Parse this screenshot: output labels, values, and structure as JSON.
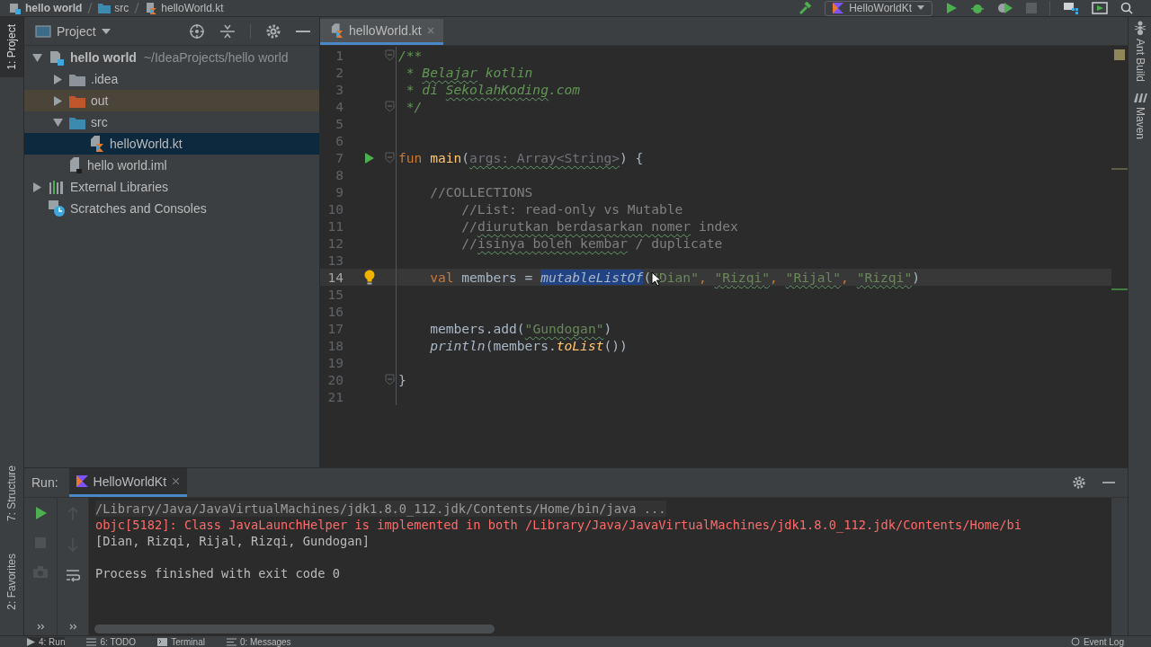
{
  "breadcrumbs": [
    {
      "kind": "module",
      "label": "hello world"
    },
    {
      "kind": "folder",
      "label": "src"
    },
    {
      "kind": "kotlin-file",
      "label": "helloWorld.kt"
    }
  ],
  "run_config": {
    "label": "HelloWorldKt"
  },
  "left_stripe": [
    {
      "label": "1: Project",
      "selected": true
    },
    {
      "label": "7: Structure",
      "selected": false
    },
    {
      "label": "2: Favorites",
      "selected": false
    }
  ],
  "right_stripe": [
    {
      "label": "Ant Build",
      "kind": "ant"
    },
    {
      "label": "Maven",
      "kind": "maven"
    }
  ],
  "project_panel": {
    "title": "Project"
  },
  "tree": [
    {
      "kind": "module",
      "label": "hello world",
      "path": "~/IdeaProjects/hello world",
      "expanded": true,
      "selected": false,
      "excluded": false,
      "children": [
        {
          "kind": "folder",
          "label": ".idea",
          "color": "#8c9499",
          "expanded": false,
          "selected": false,
          "excluded": false
        },
        {
          "kind": "folder",
          "label": "out",
          "color": "#c0562b",
          "expanded": false,
          "selected": false,
          "excluded": true
        },
        {
          "kind": "folder",
          "label": "src",
          "color": "#3c8ab0",
          "expanded": true,
          "selected": false,
          "excluded": false,
          "children": [
            {
              "kind": "kotlin-file",
              "label": "helloWorld.kt",
              "selected": true,
              "excluded": false
            }
          ]
        },
        {
          "kind": "iml-file",
          "label": "hello world.iml",
          "selected": false,
          "excluded": false
        }
      ]
    },
    {
      "kind": "libraries",
      "label": "External Libraries",
      "expanded": false,
      "selected": false,
      "excluded": false
    },
    {
      "kind": "scratches",
      "label": "Scratches and Consoles",
      "selected": false,
      "excluded": false
    }
  ],
  "editor_tabs": [
    {
      "label": "helloWorld.kt",
      "selected": true
    }
  ],
  "code": [
    {
      "number": "1",
      "fold": true,
      "tokens": [
        {
          "kind": "doc",
          "text": "/**"
        }
      ]
    },
    {
      "number": "2",
      "tokens": [
        {
          "kind": "doc",
          "text": " * "
        },
        {
          "kind": "doc",
          "text": "Belajar",
          "typo": true
        },
        {
          "kind": "doc",
          "text": " kotlin"
        }
      ]
    },
    {
      "number": "3",
      "tokens": [
        {
          "kind": "doc",
          "text": " * di "
        },
        {
          "kind": "doc",
          "text": "SekolahKoding",
          "typo": true
        },
        {
          "kind": "doc",
          "text": ".com"
        }
      ]
    },
    {
      "number": "4",
      "fold": true,
      "tokens": [
        {
          "kind": "doc",
          "text": " */"
        }
      ]
    },
    {
      "number": "5"
    },
    {
      "number": "6"
    },
    {
      "number": "7",
      "fold": true,
      "run_marker": true,
      "tokens": [
        {
          "kind": "keyword",
          "text": "fun "
        },
        {
          "kind": "function",
          "text": "main"
        },
        {
          "kind": "plain",
          "text": "("
        },
        {
          "kind": "unused",
          "text": "args: Array<String>",
          "typo": true
        },
        {
          "kind": "plain",
          "text": ") {"
        }
      ]
    },
    {
      "number": "8"
    },
    {
      "number": "9",
      "tokens": [
        {
          "kind": "comment",
          "text": "    //COLLECTIONS"
        }
      ]
    },
    {
      "number": "10",
      "tokens": [
        {
          "kind": "comment",
          "text": "        //List: read-only vs Mutable"
        }
      ]
    },
    {
      "number": "11",
      "tokens": [
        {
          "kind": "comment",
          "text": "        //"
        },
        {
          "kind": "comment",
          "text": "diurutkan berdasarkan nomer",
          "typo": true
        },
        {
          "kind": "comment",
          "text": " index"
        }
      ]
    },
    {
      "number": "12",
      "tokens": [
        {
          "kind": "comment",
          "text": "        //"
        },
        {
          "kind": "comment",
          "text": "isinya boleh kembar",
          "typo": true
        },
        {
          "kind": "comment",
          "text": " / duplicate"
        }
      ]
    },
    {
      "number": "13"
    },
    {
      "number": "14",
      "current": true,
      "intention_bulb": true,
      "tokens": [
        {
          "kind": "keyword",
          "text": "    val "
        },
        {
          "kind": "plain",
          "text": "members = "
        },
        {
          "kind": "call",
          "text": "mutableListOf",
          "selected": true
        },
        {
          "kind": "plain",
          "text": "("
        },
        {
          "kind": "string",
          "text": "\"Dian\""
        },
        {
          "kind": "keyword",
          "text": ", "
        },
        {
          "kind": "string",
          "text": "\"Rizqi\"",
          "typo": true
        },
        {
          "kind": "keyword",
          "text": ", "
        },
        {
          "kind": "string",
          "text": "\"Rijal\"",
          "typo": true
        },
        {
          "kind": "keyword",
          "text": ", "
        },
        {
          "kind": "string",
          "text": "\"Rizqi\"",
          "typo": true
        },
        {
          "kind": "plain",
          "text": ")"
        }
      ]
    },
    {
      "number": "15"
    },
    {
      "number": "16"
    },
    {
      "number": "17",
      "tokens": [
        {
          "kind": "plain",
          "text": "    members.add("
        },
        {
          "kind": "string",
          "text": "\"Gundogan\"",
          "typo": true
        },
        {
          "kind": "plain",
          "text": ")"
        }
      ]
    },
    {
      "number": "18",
      "tokens": [
        {
          "kind": "call",
          "text": "    println"
        },
        {
          "kind": "plain",
          "text": "(members."
        },
        {
          "kind": "extension",
          "text": "toList"
        },
        {
          "kind": "plain",
          "text": "())"
        }
      ]
    },
    {
      "number": "19"
    },
    {
      "number": "20",
      "fold": true,
      "tokens": [
        {
          "kind": "plain",
          "text": "}"
        }
      ]
    },
    {
      "number": "21"
    }
  ],
  "run_panel": {
    "label": "Run:",
    "tabs": [
      {
        "label": "HelloWorldKt",
        "selected": true
      }
    ],
    "console": [
      {
        "kind": "command",
        "text": "/Library/Java/JavaVirtualMachines/jdk1.8.0_112.jdk/Contents/Home/bin/java ..."
      },
      {
        "kind": "error",
        "text": "objc[5182]: Class JavaLaunchHelper is implemented in both /Library/Java/JavaVirtualMachines/jdk1.8.0_112.jdk/Contents/Home/bi"
      },
      {
        "kind": "output",
        "text": "[Dian, Rizqi, Rijal, Rizqi, Gundogan]"
      },
      {
        "kind": "status",
        "text": "Process finished with exit code 0"
      }
    ]
  },
  "status_bar": [
    {
      "kind": "run",
      "label": "4: Run",
      "selected": true
    },
    {
      "kind": "todo",
      "label": "6: TODO",
      "selected": false
    },
    {
      "kind": "terminal",
      "label": "Terminal",
      "selected": false
    },
    {
      "kind": "messages",
      "label": "0: Messages",
      "selected": false
    },
    {
      "kind": "event-log",
      "label": "Event Log",
      "selected": false
    }
  ]
}
